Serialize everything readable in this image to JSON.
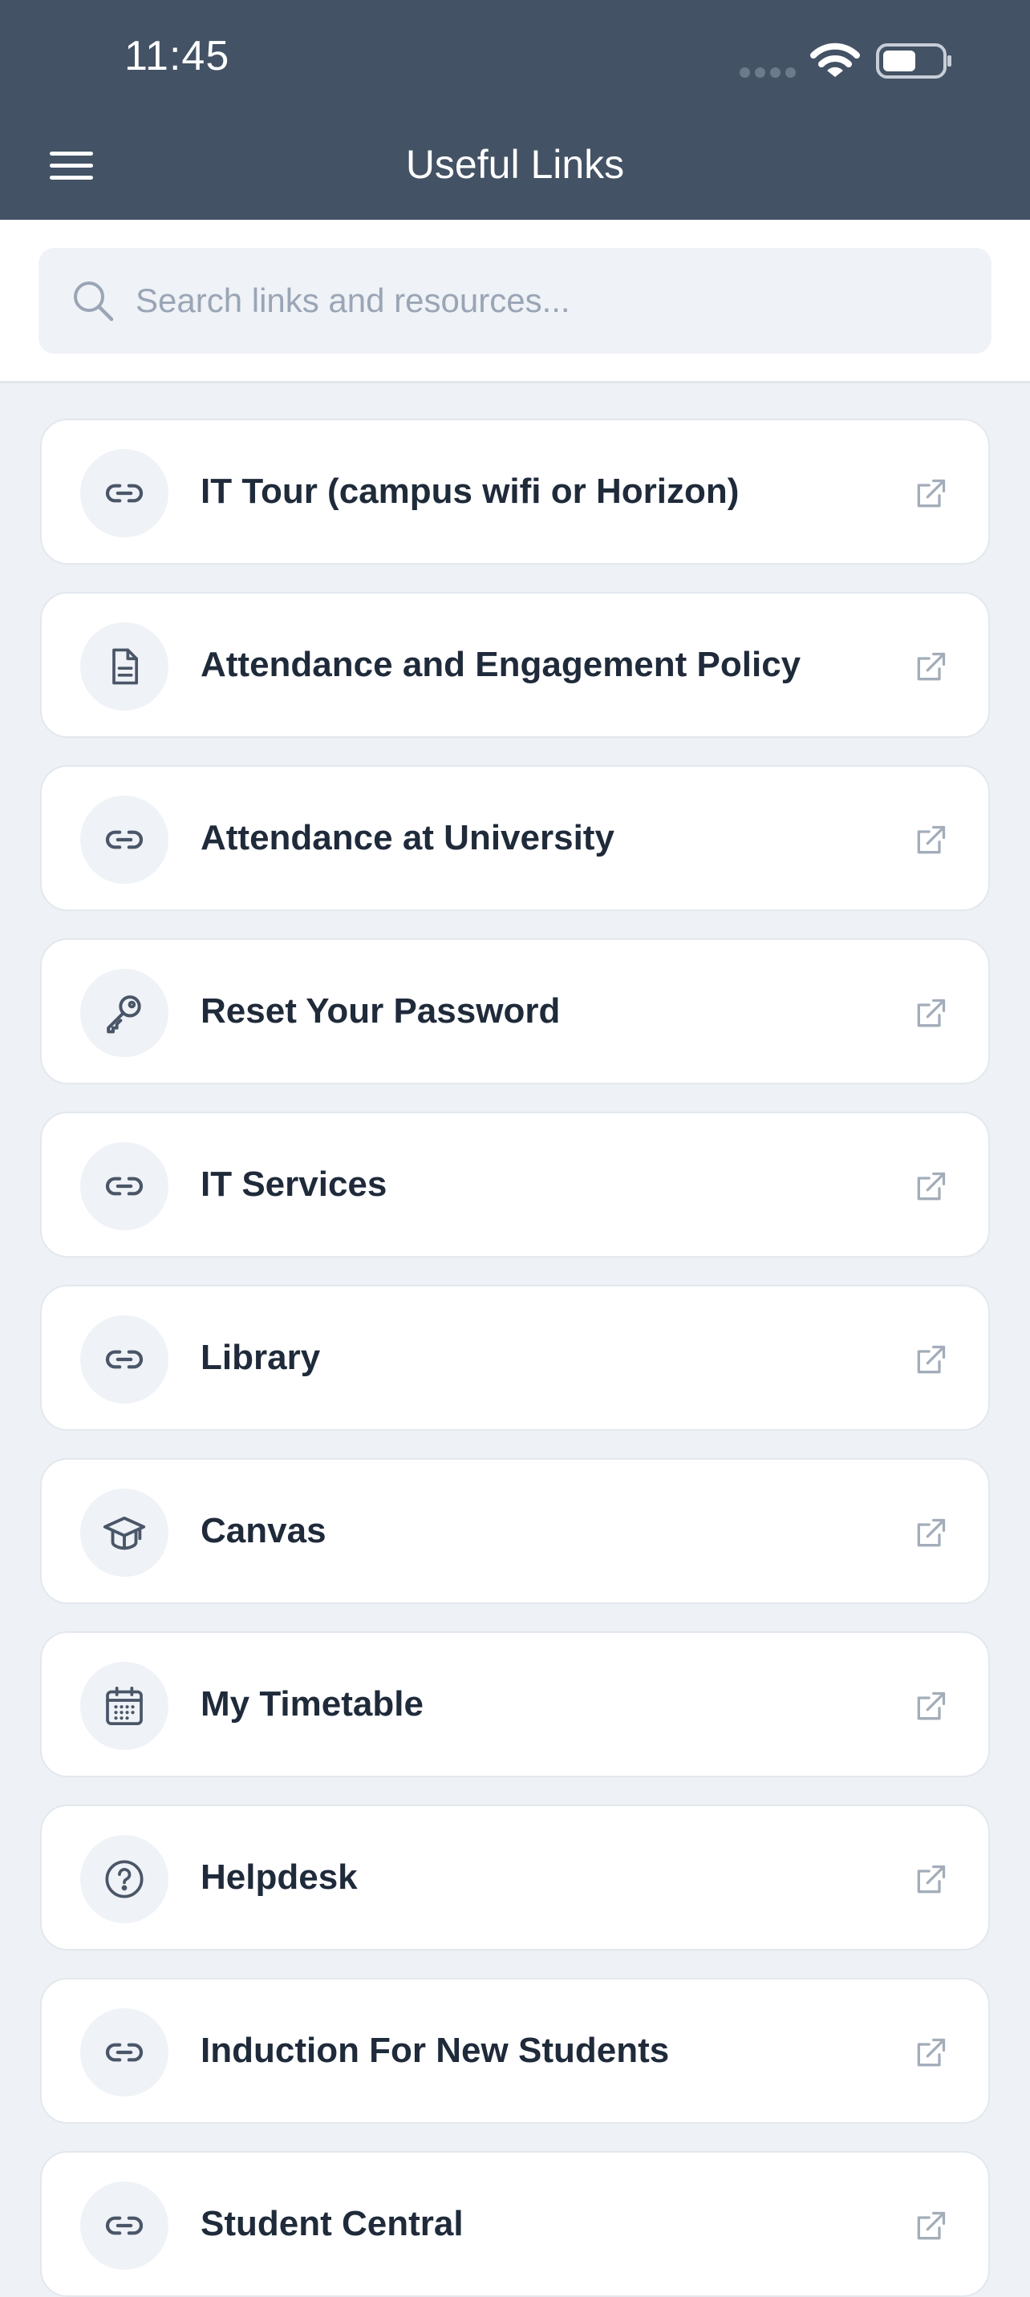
{
  "status_bar": {
    "time": "11:45"
  },
  "header": {
    "title": "Useful Links",
    "menu_icon": "hamburger-menu-icon"
  },
  "search": {
    "placeholder": "Search links and resources...",
    "icon": "search-icon"
  },
  "links": [
    {
      "label": "IT Tour (campus wifi or Horizon)",
      "icon": "link-icon"
    },
    {
      "label": "Attendance and Engagement Policy",
      "icon": "document-icon"
    },
    {
      "label": "Attendance at University",
      "icon": "link-icon"
    },
    {
      "label": "Reset Your Password",
      "icon": "key-icon"
    },
    {
      "label": "IT Services",
      "icon": "link-icon"
    },
    {
      "label": "Library",
      "icon": "link-icon"
    },
    {
      "label": "Canvas",
      "icon": "graduation-cap-icon"
    },
    {
      "label": "My Timetable",
      "icon": "calendar-icon"
    },
    {
      "label": "Helpdesk",
      "icon": "help-circle-icon"
    },
    {
      "label": "Induction For New Students",
      "icon": "link-icon"
    },
    {
      "label": "Student Central",
      "icon": "link-icon"
    }
  ],
  "colors": {
    "header_bg": "#435264",
    "page_bg": "#eef1f5",
    "card_bg": "#ffffff",
    "text": "#1f2a3a",
    "icon": "#4a5668",
    "muted_icon": "#a3adba"
  }
}
